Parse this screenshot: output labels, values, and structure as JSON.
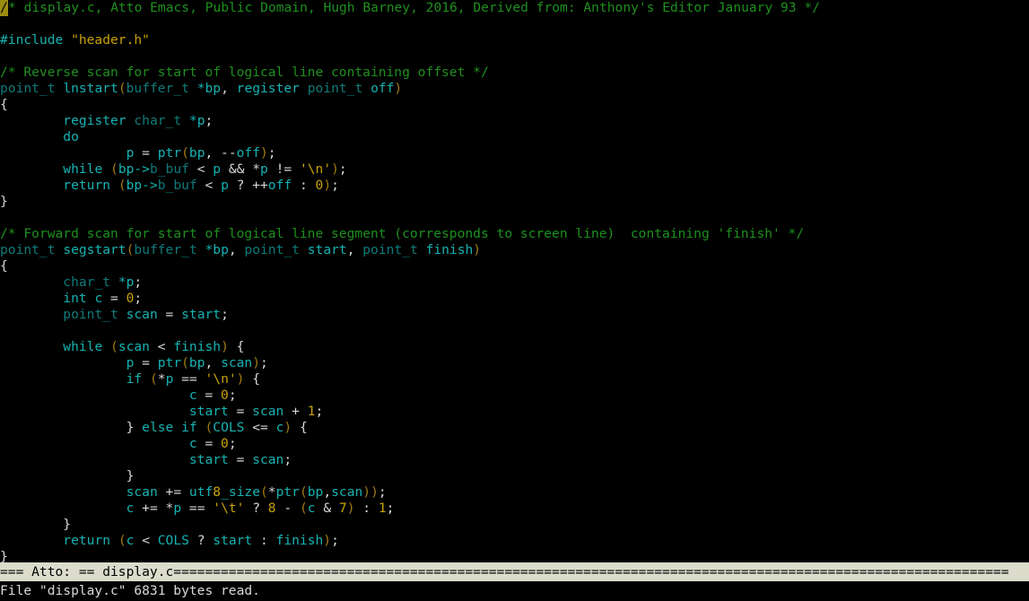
{
  "app": {
    "name": "Atto Emacs",
    "filename": "display.c"
  },
  "cursor": {
    "char": "/",
    "line": 1,
    "column": 1
  },
  "colors": {
    "background": "#000000",
    "foreground": "#d8d8d8",
    "comment": "#1f8f1f",
    "keyword": "#17b2b2",
    "type": "#107a7a",
    "string": "#c8a20a",
    "number": "#c8a20a",
    "punctuation": "#a07a12",
    "cursor": "#9b8b10",
    "modeline_bg": "#dcdccd",
    "modeline_fg": "#000000"
  },
  "buffer": {
    "lines": [
      [
        {
          "t": "cursor",
          "s": "/"
        },
        {
          "t": "comment",
          "s": "* display.c, Atto Emacs, Public Domain, Hugh Barney, 2016, Derived from: Anthony's Editor January 93 */"
        }
      ],
      [],
      [
        {
          "t": "preproc",
          "s": "#include "
        },
        {
          "t": "string",
          "s": "\"header.h\""
        }
      ],
      [],
      [
        {
          "t": "comment",
          "s": "/* Reverse scan for start of logical line containing offset */"
        }
      ],
      [
        {
          "t": "type",
          "s": "point_t"
        },
        {
          "t": "plain",
          "s": " "
        },
        {
          "t": "ident",
          "s": "lnstart"
        },
        {
          "t": "punct",
          "s": "("
        },
        {
          "t": "type",
          "s": "buffer_t"
        },
        {
          "t": "plain",
          "s": " "
        },
        {
          "t": "ident",
          "s": "*bp"
        },
        {
          "t": "plain",
          "s": ", "
        },
        {
          "t": "ident",
          "s": "register"
        },
        {
          "t": "plain",
          "s": " "
        },
        {
          "t": "type",
          "s": "point_t"
        },
        {
          "t": "plain",
          "s": " "
        },
        {
          "t": "ident",
          "s": "off"
        },
        {
          "t": "punct",
          "s": ")"
        }
      ],
      [
        {
          "t": "plain",
          "s": "{"
        }
      ],
      [
        {
          "t": "plain",
          "s": "        "
        },
        {
          "t": "keyword",
          "s": "register"
        },
        {
          "t": "plain",
          "s": " "
        },
        {
          "t": "type",
          "s": "char_t"
        },
        {
          "t": "plain",
          "s": " "
        },
        {
          "t": "ident",
          "s": "*p"
        },
        {
          "t": "plain",
          "s": ";"
        }
      ],
      [
        {
          "t": "plain",
          "s": "        "
        },
        {
          "t": "keyword",
          "s": "do"
        }
      ],
      [
        {
          "t": "plain",
          "s": "                "
        },
        {
          "t": "ident",
          "s": "p"
        },
        {
          "t": "plain",
          "s": " = "
        },
        {
          "t": "ident",
          "s": "ptr"
        },
        {
          "t": "punct",
          "s": "("
        },
        {
          "t": "ident",
          "s": "bp"
        },
        {
          "t": "plain",
          "s": ", --"
        },
        {
          "t": "ident",
          "s": "off"
        },
        {
          "t": "punct",
          "s": ")"
        },
        {
          "t": "plain",
          "s": ";"
        }
      ],
      [
        {
          "t": "plain",
          "s": "        "
        },
        {
          "t": "keyword",
          "s": "while"
        },
        {
          "t": "plain",
          "s": " "
        },
        {
          "t": "punct",
          "s": "("
        },
        {
          "t": "ident",
          "s": "bp->"
        },
        {
          "t": "type",
          "s": "b_buf"
        },
        {
          "t": "plain",
          "s": " < "
        },
        {
          "t": "ident",
          "s": "p"
        },
        {
          "t": "plain",
          "s": " && *"
        },
        {
          "t": "ident",
          "s": "p"
        },
        {
          "t": "plain",
          "s": " != "
        },
        {
          "t": "string",
          "s": "'\\n'"
        },
        {
          "t": "punct",
          "s": ")"
        },
        {
          "t": "plain",
          "s": ";"
        }
      ],
      [
        {
          "t": "plain",
          "s": "        "
        },
        {
          "t": "keyword",
          "s": "return"
        },
        {
          "t": "plain",
          "s": " "
        },
        {
          "t": "punct",
          "s": "("
        },
        {
          "t": "ident",
          "s": "bp->"
        },
        {
          "t": "type",
          "s": "b_buf"
        },
        {
          "t": "plain",
          "s": " < "
        },
        {
          "t": "ident",
          "s": "p"
        },
        {
          "t": "plain",
          "s": " ? ++"
        },
        {
          "t": "ident",
          "s": "off"
        },
        {
          "t": "plain",
          "s": " : "
        },
        {
          "t": "number",
          "s": "0"
        },
        {
          "t": "punct",
          "s": ")"
        },
        {
          "t": "plain",
          "s": ";"
        }
      ],
      [
        {
          "t": "plain",
          "s": "}"
        }
      ],
      [],
      [
        {
          "t": "comment",
          "s": "/* Forward scan for start of logical line segment (corresponds to screen line)  containing 'finish' */"
        }
      ],
      [
        {
          "t": "type",
          "s": "point_t"
        },
        {
          "t": "plain",
          "s": " "
        },
        {
          "t": "ident",
          "s": "segstart"
        },
        {
          "t": "punct",
          "s": "("
        },
        {
          "t": "type",
          "s": "buffer_t"
        },
        {
          "t": "plain",
          "s": " "
        },
        {
          "t": "ident",
          "s": "*bp"
        },
        {
          "t": "plain",
          "s": ", "
        },
        {
          "t": "type",
          "s": "point_t"
        },
        {
          "t": "plain",
          "s": " "
        },
        {
          "t": "ident",
          "s": "start"
        },
        {
          "t": "plain",
          "s": ", "
        },
        {
          "t": "type",
          "s": "point_t"
        },
        {
          "t": "plain",
          "s": " "
        },
        {
          "t": "ident",
          "s": "finish"
        },
        {
          "t": "punct",
          "s": ")"
        }
      ],
      [
        {
          "t": "plain",
          "s": "{"
        }
      ],
      [
        {
          "t": "plain",
          "s": "        "
        },
        {
          "t": "type",
          "s": "char_t"
        },
        {
          "t": "plain",
          "s": " "
        },
        {
          "t": "ident",
          "s": "*p"
        },
        {
          "t": "plain",
          "s": ";"
        }
      ],
      [
        {
          "t": "plain",
          "s": "        "
        },
        {
          "t": "keyword",
          "s": "int"
        },
        {
          "t": "plain",
          "s": " "
        },
        {
          "t": "ident",
          "s": "c"
        },
        {
          "t": "plain",
          "s": " = "
        },
        {
          "t": "number",
          "s": "0"
        },
        {
          "t": "plain",
          "s": ";"
        }
      ],
      [
        {
          "t": "plain",
          "s": "        "
        },
        {
          "t": "type",
          "s": "point_t"
        },
        {
          "t": "plain",
          "s": " "
        },
        {
          "t": "ident",
          "s": "scan"
        },
        {
          "t": "plain",
          "s": " = "
        },
        {
          "t": "ident",
          "s": "start"
        },
        {
          "t": "plain",
          "s": ";"
        }
      ],
      [],
      [
        {
          "t": "plain",
          "s": "        "
        },
        {
          "t": "keyword",
          "s": "while"
        },
        {
          "t": "plain",
          "s": " "
        },
        {
          "t": "punct",
          "s": "("
        },
        {
          "t": "ident",
          "s": "scan"
        },
        {
          "t": "plain",
          "s": " < "
        },
        {
          "t": "ident",
          "s": "finish"
        },
        {
          "t": "punct",
          "s": ")"
        },
        {
          "t": "plain",
          "s": " {"
        }
      ],
      [
        {
          "t": "plain",
          "s": "                "
        },
        {
          "t": "ident",
          "s": "p"
        },
        {
          "t": "plain",
          "s": " = "
        },
        {
          "t": "ident",
          "s": "ptr"
        },
        {
          "t": "punct",
          "s": "("
        },
        {
          "t": "ident",
          "s": "bp"
        },
        {
          "t": "plain",
          "s": ", "
        },
        {
          "t": "ident",
          "s": "scan"
        },
        {
          "t": "punct",
          "s": ")"
        },
        {
          "t": "plain",
          "s": ";"
        }
      ],
      [
        {
          "t": "plain",
          "s": "                "
        },
        {
          "t": "keyword",
          "s": "if"
        },
        {
          "t": "plain",
          "s": " "
        },
        {
          "t": "punct",
          "s": "("
        },
        {
          "t": "plain",
          "s": "*"
        },
        {
          "t": "ident",
          "s": "p"
        },
        {
          "t": "plain",
          "s": " == "
        },
        {
          "t": "string",
          "s": "'\\n'"
        },
        {
          "t": "punct",
          "s": ")"
        },
        {
          "t": "plain",
          "s": " {"
        }
      ],
      [
        {
          "t": "plain",
          "s": "                        "
        },
        {
          "t": "ident",
          "s": "c"
        },
        {
          "t": "plain",
          "s": " = "
        },
        {
          "t": "number",
          "s": "0"
        },
        {
          "t": "plain",
          "s": ";"
        }
      ],
      [
        {
          "t": "plain",
          "s": "                        "
        },
        {
          "t": "ident",
          "s": "start"
        },
        {
          "t": "plain",
          "s": " = "
        },
        {
          "t": "ident",
          "s": "scan"
        },
        {
          "t": "plain",
          "s": " + "
        },
        {
          "t": "number",
          "s": "1"
        },
        {
          "t": "plain",
          "s": ";"
        }
      ],
      [
        {
          "t": "plain",
          "s": "                } "
        },
        {
          "t": "keyword",
          "s": "else"
        },
        {
          "t": "plain",
          "s": " "
        },
        {
          "t": "keyword",
          "s": "if"
        },
        {
          "t": "plain",
          "s": " "
        },
        {
          "t": "punct",
          "s": "("
        },
        {
          "t": "ident",
          "s": "COLS"
        },
        {
          "t": "plain",
          "s": " <= "
        },
        {
          "t": "ident",
          "s": "c"
        },
        {
          "t": "punct",
          "s": ")"
        },
        {
          "t": "plain",
          "s": " {"
        }
      ],
      [
        {
          "t": "plain",
          "s": "                        "
        },
        {
          "t": "ident",
          "s": "c"
        },
        {
          "t": "plain",
          "s": " = "
        },
        {
          "t": "number",
          "s": "0"
        },
        {
          "t": "plain",
          "s": ";"
        }
      ],
      [
        {
          "t": "plain",
          "s": "                        "
        },
        {
          "t": "ident",
          "s": "start"
        },
        {
          "t": "plain",
          "s": " = "
        },
        {
          "t": "ident",
          "s": "scan"
        },
        {
          "t": "plain",
          "s": ";"
        }
      ],
      [
        {
          "t": "plain",
          "s": "                }"
        }
      ],
      [
        {
          "t": "plain",
          "s": "                "
        },
        {
          "t": "ident",
          "s": "scan"
        },
        {
          "t": "plain",
          "s": " += "
        },
        {
          "t": "ident",
          "s": "utf"
        },
        {
          "t": "number",
          "s": "8"
        },
        {
          "t": "ident",
          "s": "_size"
        },
        {
          "t": "punct",
          "s": "("
        },
        {
          "t": "plain",
          "s": "*"
        },
        {
          "t": "ident",
          "s": "ptr"
        },
        {
          "t": "punct",
          "s": "("
        },
        {
          "t": "ident",
          "s": "bp"
        },
        {
          "t": "plain",
          "s": ","
        },
        {
          "t": "ident",
          "s": "scan"
        },
        {
          "t": "punct",
          "s": "))"
        },
        {
          "t": "plain",
          "s": ";"
        }
      ],
      [
        {
          "t": "plain",
          "s": "                "
        },
        {
          "t": "ident",
          "s": "c"
        },
        {
          "t": "plain",
          "s": " += *"
        },
        {
          "t": "ident",
          "s": "p"
        },
        {
          "t": "plain",
          "s": " == "
        },
        {
          "t": "string",
          "s": "'\\t'"
        },
        {
          "t": "plain",
          "s": " ? "
        },
        {
          "t": "number",
          "s": "8"
        },
        {
          "t": "plain",
          "s": " - "
        },
        {
          "t": "punct",
          "s": "("
        },
        {
          "t": "ident",
          "s": "c"
        },
        {
          "t": "plain",
          "s": " & "
        },
        {
          "t": "number",
          "s": "7"
        },
        {
          "t": "punct",
          "s": ")"
        },
        {
          "t": "plain",
          "s": " : "
        },
        {
          "t": "number",
          "s": "1"
        },
        {
          "t": "plain",
          "s": ";"
        }
      ],
      [
        {
          "t": "plain",
          "s": "        }"
        }
      ],
      [
        {
          "t": "plain",
          "s": "        "
        },
        {
          "t": "keyword",
          "s": "return"
        },
        {
          "t": "plain",
          "s": " "
        },
        {
          "t": "punct",
          "s": "("
        },
        {
          "t": "ident",
          "s": "c"
        },
        {
          "t": "plain",
          "s": " < "
        },
        {
          "t": "ident",
          "s": "COLS"
        },
        {
          "t": "plain",
          "s": " ? "
        },
        {
          "t": "ident",
          "s": "start"
        },
        {
          "t": "plain",
          "s": " : "
        },
        {
          "t": "ident",
          "s": "finish"
        },
        {
          "t": "punct",
          "s": ")"
        },
        {
          "t": "plain",
          "s": ";"
        }
      ],
      [
        {
          "t": "plain",
          "s": "}"
        }
      ]
    ]
  },
  "mode_line": {
    "text": "=== Atto: == display.c=================================================================================================================",
    "prefix": "=== ",
    "app_label": "Atto:",
    "separator": "== ",
    "buffer_name": "display.c",
    "fill_char": "="
  },
  "echo_area": {
    "message": "File \"display.c\" 6831 bytes read.",
    "file": "display.c",
    "bytes": "6831"
  }
}
